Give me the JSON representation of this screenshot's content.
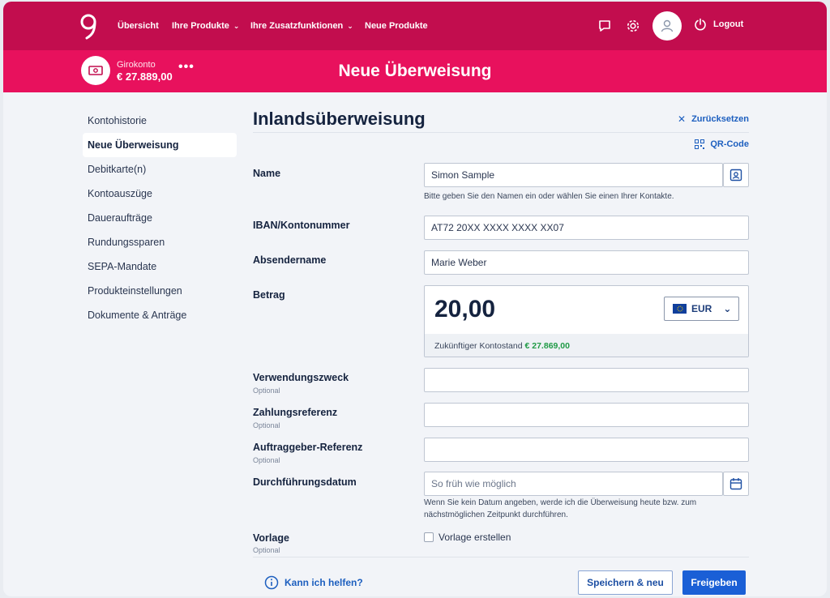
{
  "topbar": {
    "nav": [
      "Übersicht",
      "Ihre Produkte",
      "Ihre Zusatzfunktionen",
      "Neue Produkte"
    ],
    "logout_label": "Logout"
  },
  "account": {
    "name": "Girokonto",
    "balance": "€ 27.889,00",
    "more": "•••"
  },
  "page": {
    "title": "Neue Überweisung"
  },
  "sidebar": {
    "items": [
      {
        "label": "Kontohistorie"
      },
      {
        "label": "Neue Überweisung",
        "active": true
      },
      {
        "label": "Debitkarte(n)"
      },
      {
        "label": "Kontoauszüge"
      },
      {
        "label": "Daueraufträge"
      },
      {
        "label": "Rundungssparen"
      },
      {
        "label": "SEPA-Mandate"
      },
      {
        "label": "Produkteinstellungen"
      },
      {
        "label": "Dokumente & Anträge"
      }
    ]
  },
  "form": {
    "title": "Inlandsüberweisung",
    "reset_label": "Zurücksetzen",
    "qr_label": "QR-Code",
    "name": {
      "label": "Name",
      "value": "Simon Sample",
      "hint": "Bitte geben Sie den Namen ein oder wählen Sie einen Ihrer Kontakte."
    },
    "iban": {
      "label": "IBAN/Kontonummer",
      "value": "AT72 20XX XXXX XXXX XX07"
    },
    "sender": {
      "label": "Absendername",
      "value": "Marie Weber"
    },
    "amount": {
      "label": "Betrag",
      "value": "20,00",
      "currency": "EUR",
      "future_label": "Zukünftiger Kontostand",
      "future_value": "€ 27.869,00"
    },
    "purpose": {
      "label": "Verwendungszweck",
      "optional": "Optional",
      "value": ""
    },
    "payment_ref": {
      "label": "Zahlungsreferenz",
      "optional": "Optional",
      "value": ""
    },
    "client_ref": {
      "label": "Auftraggeber-Referenz",
      "optional": "Optional",
      "value": ""
    },
    "date": {
      "label": "Durchführungsdatum",
      "placeholder": "So früh wie möglich",
      "hint": "Wenn Sie kein Datum angeben, werde ich die Überweisung heute bzw. zum nächstmöglichen Zeitpunkt durchführen."
    },
    "template": {
      "label": "Vorlage",
      "optional": "Optional",
      "checkbox_label": "Vorlage erstellen",
      "checked": false
    }
  },
  "footer": {
    "help_label": "Kann ich helfen?",
    "save_new_label": "Speichern & neu",
    "submit_label": "Freigeben"
  },
  "colors": {
    "brand_dark": "#c20d4e",
    "brand": "#e8115d",
    "accent": "#1a5fd6",
    "positive": "#1f9a45"
  }
}
